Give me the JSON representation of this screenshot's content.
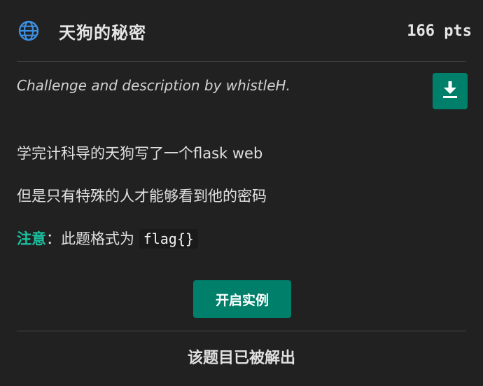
{
  "challenge": {
    "title": "天狗的秘密",
    "points": "166 pts",
    "icon": "globe-icon",
    "description_credit": "Challenge and description by whistleH.",
    "body_line_1": "学完计科导的天狗写了一个flask web",
    "body_line_2": "但是只有特殊的人才能够看到他的密码",
    "note_label": "注意",
    "note_sep": "：",
    "note_text": "此题格式为",
    "flag_format": "flag{}"
  },
  "actions": {
    "download_icon": "download-icon",
    "start_instance_label": "开启实例"
  },
  "status": {
    "solved_text": "该题目已被解出"
  },
  "colors": {
    "background": "#212121",
    "accent": "#00806a",
    "note": "#19c2a0",
    "globe": "#3d8fe0"
  }
}
